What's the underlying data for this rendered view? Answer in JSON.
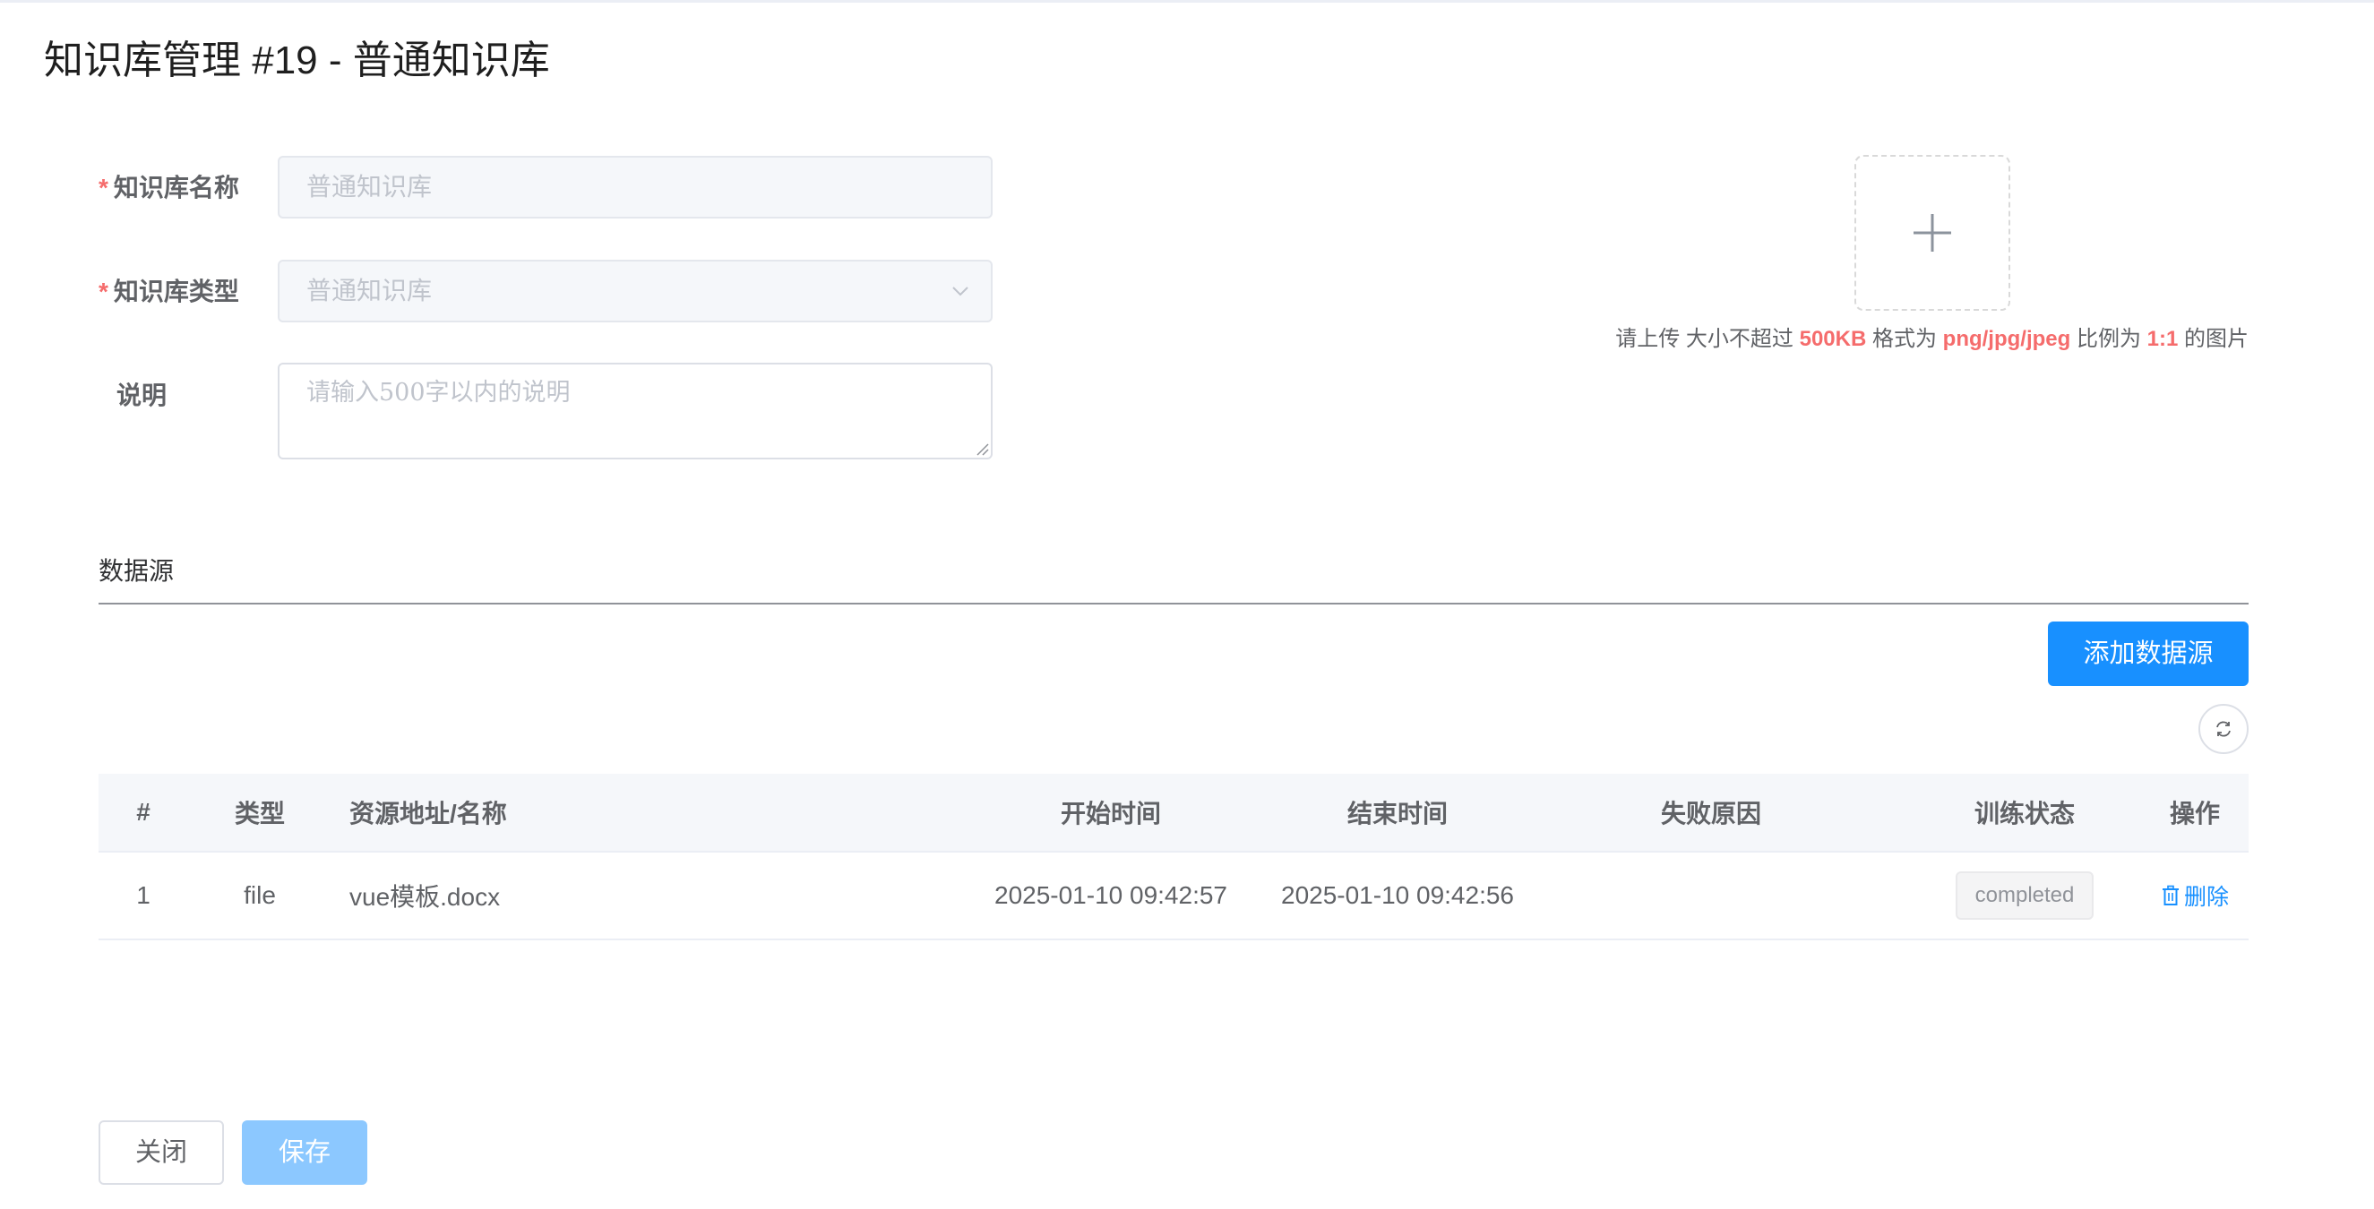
{
  "page": {
    "title": "知识库管理 #19 - 普通知识库"
  },
  "form": {
    "name_label": "知识库名称",
    "name_value": "普通知识库",
    "type_label": "知识库类型",
    "type_value": "普通知识库",
    "desc_label": "说明",
    "desc_placeholder": "请输入500字以内的说明",
    "required_mark": "*",
    "select_icon": "chevron-down-icon"
  },
  "upload": {
    "icon": "plus-icon",
    "tip_prefix": "请上传 大小不超过",
    "tip_size": "500KB",
    "tip_format_label": "格式为",
    "tip_format": "png/jpg/jpeg",
    "tip_ratio_label": "比例为",
    "tip_ratio": "1:1",
    "tip_suffix": "的图片"
  },
  "datasource": {
    "section_title": "数据源",
    "add_button": "添加数据源",
    "refresh_icon": "refresh-icon",
    "columns": [
      "#",
      "类型",
      "资源地址/名称",
      "开始时间",
      "结束时间",
      "失败原因",
      "训练状态",
      "操作"
    ],
    "rows": [
      {
        "index": "1",
        "type": "file",
        "source": "vue模板.docx",
        "start_time": "2025-01-10 09:42:57",
        "end_time": "2025-01-10 09:42:56",
        "fail_reason": "",
        "status": "completed",
        "action": "删除"
      }
    ]
  },
  "footer": {
    "close_label": "关闭",
    "save_label": "保存"
  },
  "colors": {
    "primary": "#1890ff",
    "primary_disabled": "#8cc8ff",
    "danger": "#f56c6c",
    "required": "#f56c6c"
  }
}
